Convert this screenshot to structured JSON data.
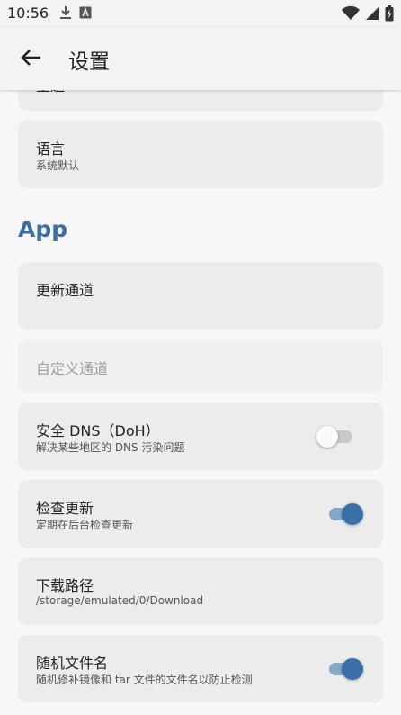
{
  "status_bar": {
    "time": "10:56",
    "left_icons": [
      "download-icon",
      "font-icon"
    ],
    "right_icons": [
      "wifi-icon",
      "cell-signal-icon",
      "battery-charging-icon"
    ]
  },
  "app_bar": {
    "back_icon": "back-arrow-icon",
    "title": "设置"
  },
  "partial_card": {
    "title_fragment": "主题"
  },
  "settings_general": [
    {
      "id": "language",
      "title": "语言",
      "subtitle": "系统默认"
    }
  ],
  "section_app": {
    "title": "App"
  },
  "settings_app": [
    {
      "id": "update_channel",
      "title": "更新通道",
      "subtitle": ""
    },
    {
      "id": "custom_channel",
      "title": "自定义通道",
      "disabled": true
    },
    {
      "id": "secure_dns",
      "title": "安全 DNS（DoH）",
      "subtitle": "解决某些地区的 DNS 污染问题",
      "switch": false
    },
    {
      "id": "check_update",
      "title": "检查更新",
      "subtitle": "定期在后台检查更新",
      "switch": true
    },
    {
      "id": "download_path",
      "title": "下载路径",
      "subtitle": "/storage/emulated/0/Download"
    },
    {
      "id": "random_filename",
      "title": "随机文件名",
      "subtitle": "随机修补镜像和 tar 文件的文件名以防止检测",
      "switch": true
    }
  ],
  "colors": {
    "accent": "#3d6e9e",
    "switch_on_thumb": "#3a6ea7",
    "switch_on_track": "#86a7c8",
    "card_bg": "#ececec",
    "page_bg": "#f7f7f7"
  }
}
